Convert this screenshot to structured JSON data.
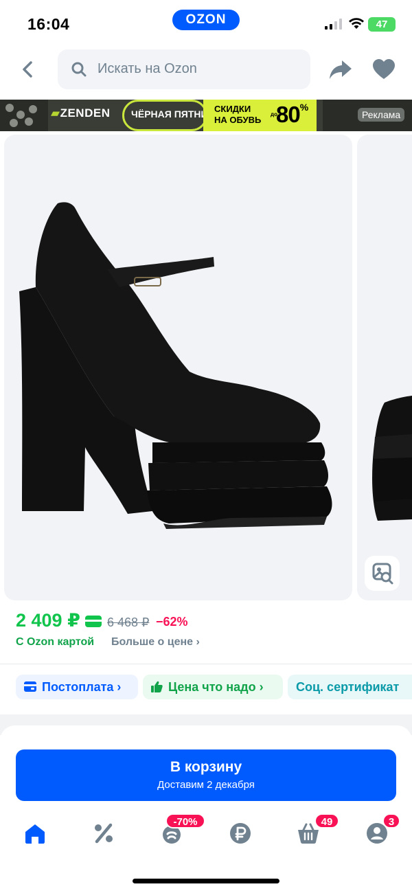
{
  "status_bar": {
    "time": "16:04",
    "brand_pill": "OZON",
    "battery": "47"
  },
  "nav": {
    "search_placeholder": "Искать на Ozon"
  },
  "ad_banner": {
    "brand": "ZENDEN",
    "event": "ЧЁРНАЯ ПЯТНИЦА",
    "discount_line1": "СКИДКИ",
    "discount_line2": "НА ОБУВЬ",
    "discount_prefix": "до",
    "discount_value": "80",
    "discount_unit": "%",
    "label": "Реклама"
  },
  "product": {
    "price_now": "2 409 ₽",
    "price_old": "6 468 ₽",
    "discount": "−62%",
    "card_caption": "С Ozon картой",
    "more_about_price": "Больше о цене ›"
  },
  "chips": [
    {
      "label": "Постоплата ›",
      "icon": "wallet-icon"
    },
    {
      "label": "Цена что надо ›",
      "icon": "thumbs-up-icon"
    },
    {
      "label": "Соц. сертификат",
      "icon": null
    }
  ],
  "cart_button": {
    "title": "В корзину",
    "subtitle": "Доставим 2 декабря"
  },
  "tabbar": {
    "items": [
      {
        "name": "home-icon"
      },
      {
        "name": "percent-icon"
      },
      {
        "name": "fresh-icon",
        "badge": "-70%"
      },
      {
        "name": "ruble-icon"
      },
      {
        "name": "cart-icon",
        "badge": "49"
      },
      {
        "name": "profile-icon",
        "badge": "3"
      }
    ]
  },
  "colors": {
    "brand_blue": "#005bff",
    "price_green": "#10c44c",
    "discount_red": "#f91155"
  }
}
